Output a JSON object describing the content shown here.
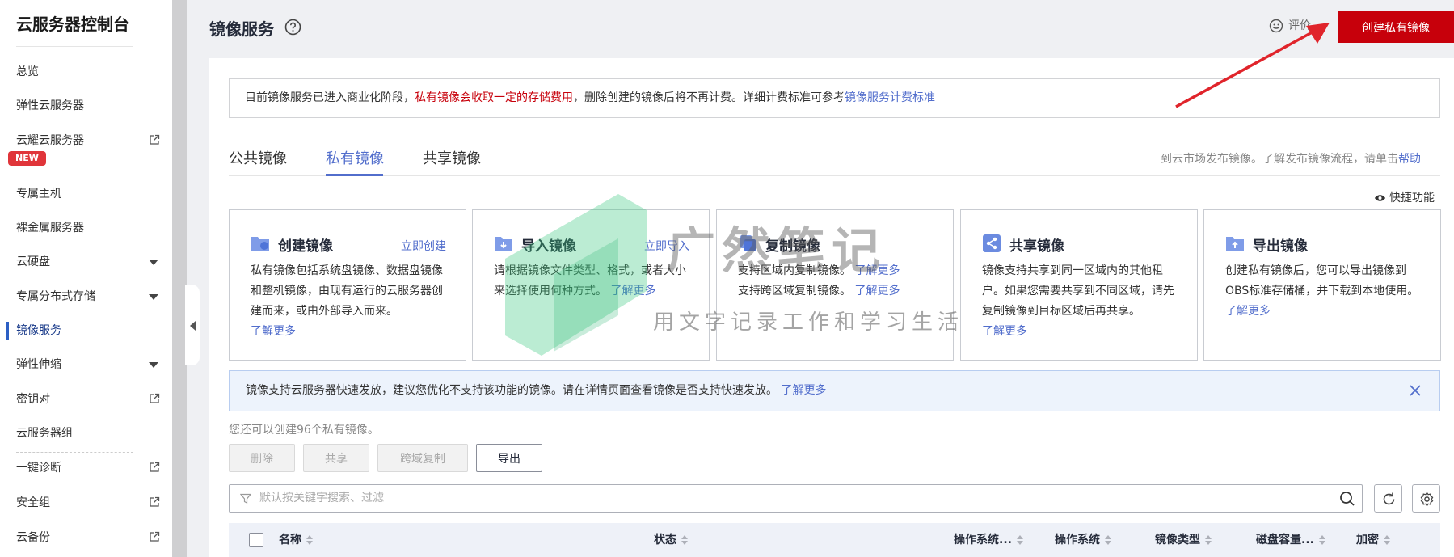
{
  "sidebar": {
    "title": "云服务器控制台",
    "items": [
      {
        "label": "总览"
      },
      {
        "label": "弹性云服务器"
      },
      {
        "label": "云耀云服务器",
        "badge": "NEW"
      },
      {
        "label": "专属主机"
      },
      {
        "label": "裸金属服务器"
      },
      {
        "label": "云硬盘"
      },
      {
        "label": "专属分布式存储"
      },
      {
        "label": "镜像服务"
      },
      {
        "label": "弹性伸缩"
      },
      {
        "label": "密钥对"
      },
      {
        "label": "云服务器组"
      },
      {
        "label": "一键诊断"
      },
      {
        "label": "安全组"
      },
      {
        "label": "云备份"
      }
    ]
  },
  "header": {
    "title": "镜像服务",
    "rate_label": "评价",
    "create_button": "创建私有镜像"
  },
  "notice": {
    "part1": "目前镜像服务已进入商业化阶段，",
    "part2": "私有镜像会收取一定的存储费用",
    "part3": "，删除创建的镜像后将不再计费。详细计费标准可参考",
    "link": "镜像服务计费标准"
  },
  "tabs": {
    "items": [
      {
        "label": "公共镜像"
      },
      {
        "label": "私有镜像"
      },
      {
        "label": "共享镜像"
      }
    ],
    "right_text": "到云市场发布镜像。了解发布镜像流程，请单击",
    "right_link": "帮助"
  },
  "shortcut_label": "快捷功能",
  "features": [
    {
      "title": "创建镜像",
      "action": "立即创建",
      "desc": "私有镜像包括系统盘镜像、数据盘镜像和整机镜像，由现有运行的云服务器创建而来，或由外部导入而来。",
      "more": "了解更多"
    },
    {
      "title": "导入镜像",
      "action": "立即导入",
      "desc": "请根据镜像文件类型、格式，或者大小来选择使用何种方式。",
      "more": "了解更多"
    },
    {
      "title": "复制镜像",
      "desc_lines": [
        {
          "text": "支持区域内复制镜像。",
          "more": "了解更多"
        },
        {
          "text": "支持跨区域复制镜像。",
          "more": "了解更多"
        }
      ]
    },
    {
      "title": "共享镜像",
      "desc": "镜像支持共享到同一区域内的其他租户。如果您需要共享到不同区域，请先复制镜像到目标区域后再共享。",
      "more": "了解更多"
    },
    {
      "title": "导出镜像",
      "desc": "创建私有镜像后，您可以导出镜像到OBS标准存储桶，并下载到本地使用。",
      "more": "了解更多"
    }
  ],
  "watermark": {
    "title": "广然笔记",
    "subtitle": "用文字记录工作和学习生活"
  },
  "info_bar": {
    "text": "镜像支持云服务器快速发放，建议您优化不支持该功能的镜像。请在详情页面查看镜像是否支持快速发放。",
    "link": "了解更多"
  },
  "quota_text": "您还可以创建96个私有镜像。",
  "actions": [
    {
      "label": "删除"
    },
    {
      "label": "共享"
    },
    {
      "label": "跨域复制"
    },
    {
      "label": "导出"
    }
  ],
  "search": {
    "placeholder": "默认按关键字搜索、过滤"
  },
  "table": {
    "columns": [
      {
        "label": "名称"
      },
      {
        "label": "状态"
      },
      {
        "label": "操作系统..."
      },
      {
        "label": "操作系统"
      },
      {
        "label": "镜像类型"
      },
      {
        "label": "磁盘容量..."
      },
      {
        "label": "加密"
      }
    ]
  },
  "colors": {
    "accent": "#526ecc",
    "brand_red": "#c7000b",
    "page_bg": "#eff0f3"
  }
}
